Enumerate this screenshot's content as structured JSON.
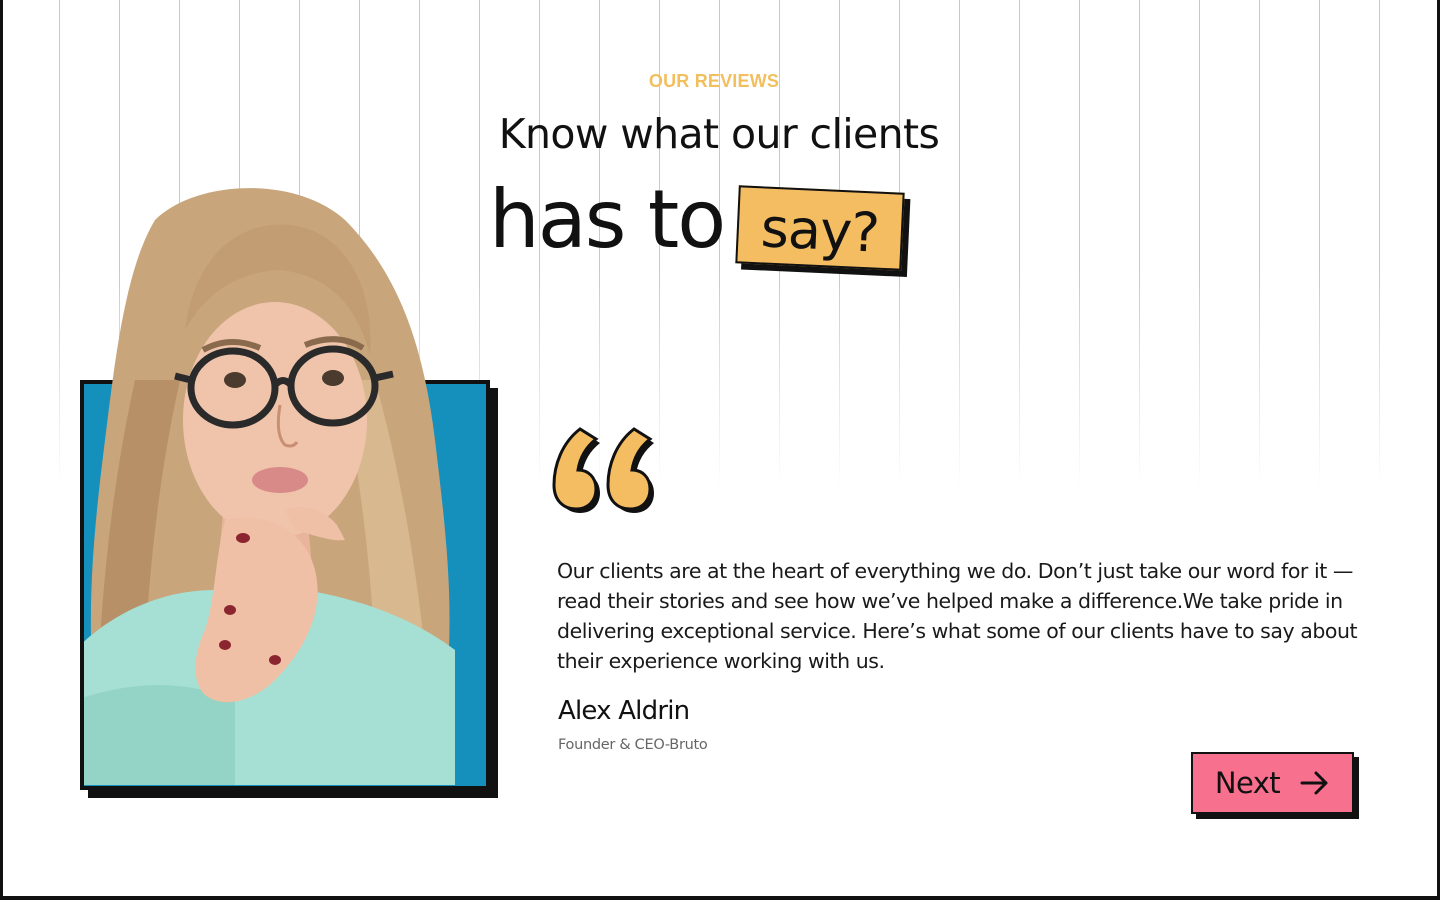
{
  "section": {
    "eyebrow": "OUR REVIEWS",
    "heading_line1": "Know what our clients",
    "heading_line2": "has to",
    "heading_highlight": "say?"
  },
  "testimonial": {
    "quote": "Our clients are at the heart of everything we do. Don’t just take our word for it  — read their stories and see how we’ve helped make a difference.We take pride in delivering exceptional service. Here’s what some of our clients have to say about their experience working with us.",
    "author_name": "Alex Aldrin",
    "author_role": "Founder & CEO-Bruto",
    "photo_icon": "person-thinking-photo",
    "quote_icon": "quote-mark-icon"
  },
  "navigation": {
    "next_label": "Next",
    "next_icon": "arrow-right-icon"
  },
  "colors": {
    "accent_yellow": "#f5bd62",
    "eyebrow_yellow": "#f2bf5e",
    "button_pink": "#f7708e",
    "photo_background": "#1590bd",
    "ink": "#111111"
  }
}
